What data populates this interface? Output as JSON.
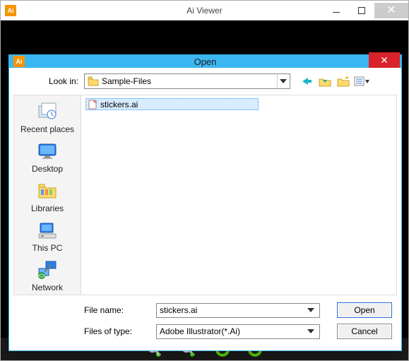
{
  "outer": {
    "title": "Ai Viewer",
    "app_icon_letter": "Ai"
  },
  "dialog": {
    "title": "Open",
    "app_icon_letter": "Ai",
    "lookin_label": "Look in:",
    "lookin_value": "Sample-Files",
    "nav_icons": [
      "back",
      "up-folder",
      "new-folder",
      "view-menu"
    ],
    "sidebar": [
      {
        "id": "recent",
        "label": "Recent places"
      },
      {
        "id": "desktop",
        "label": "Desktop"
      },
      {
        "id": "libraries",
        "label": "Libraries"
      },
      {
        "id": "thispc",
        "label": "This PC"
      },
      {
        "id": "network",
        "label": "Network"
      }
    ],
    "files": [
      {
        "name": "stickers.ai"
      }
    ],
    "filename_label": "File name:",
    "filename_value": "stickers.ai",
    "filetype_label": "Files of type:",
    "filetype_value": "Adobe Illustrator(*.Ai)",
    "open_button": "Open",
    "cancel_button": "Cancel"
  },
  "toolbar": {
    "items": [
      "zoom-in",
      "zoom-out",
      "rotate-left",
      "rotate-right"
    ]
  }
}
